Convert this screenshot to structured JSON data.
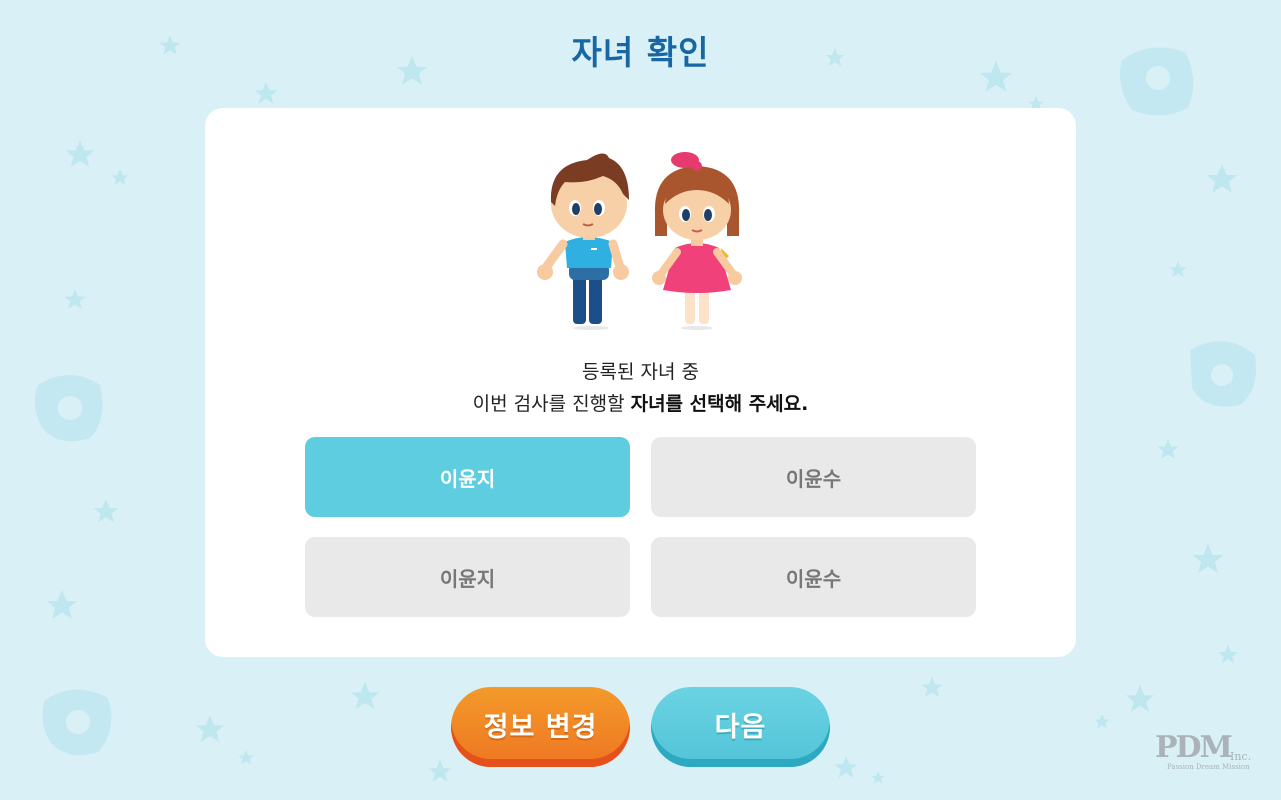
{
  "page": {
    "title": "자녀 확인"
  },
  "instruction": {
    "line1": "등록된 자녀 중",
    "line2_normal": "이번 검사를 진행할 ",
    "line2_bold": "자녀를 선택해 주세요."
  },
  "children": [
    {
      "label": "이윤지",
      "selected": true
    },
    {
      "label": "이윤수",
      "selected": false
    },
    {
      "label": "이윤지",
      "selected": false
    },
    {
      "label": "이윤수",
      "selected": false
    }
  ],
  "actions": {
    "edit_label": "정보 변경",
    "next_label": "다음"
  },
  "logo": {
    "mark": "PDM",
    "suffix": "Inc.",
    "tagline": "Passion Dream Mission"
  },
  "colors": {
    "background": "#d9f1f6",
    "title": "#1667a3",
    "selected": "#5ecde0",
    "unselected": "#e9e9e9",
    "orange_button": "#ef8424",
    "blue_button": "#5ecde0"
  }
}
